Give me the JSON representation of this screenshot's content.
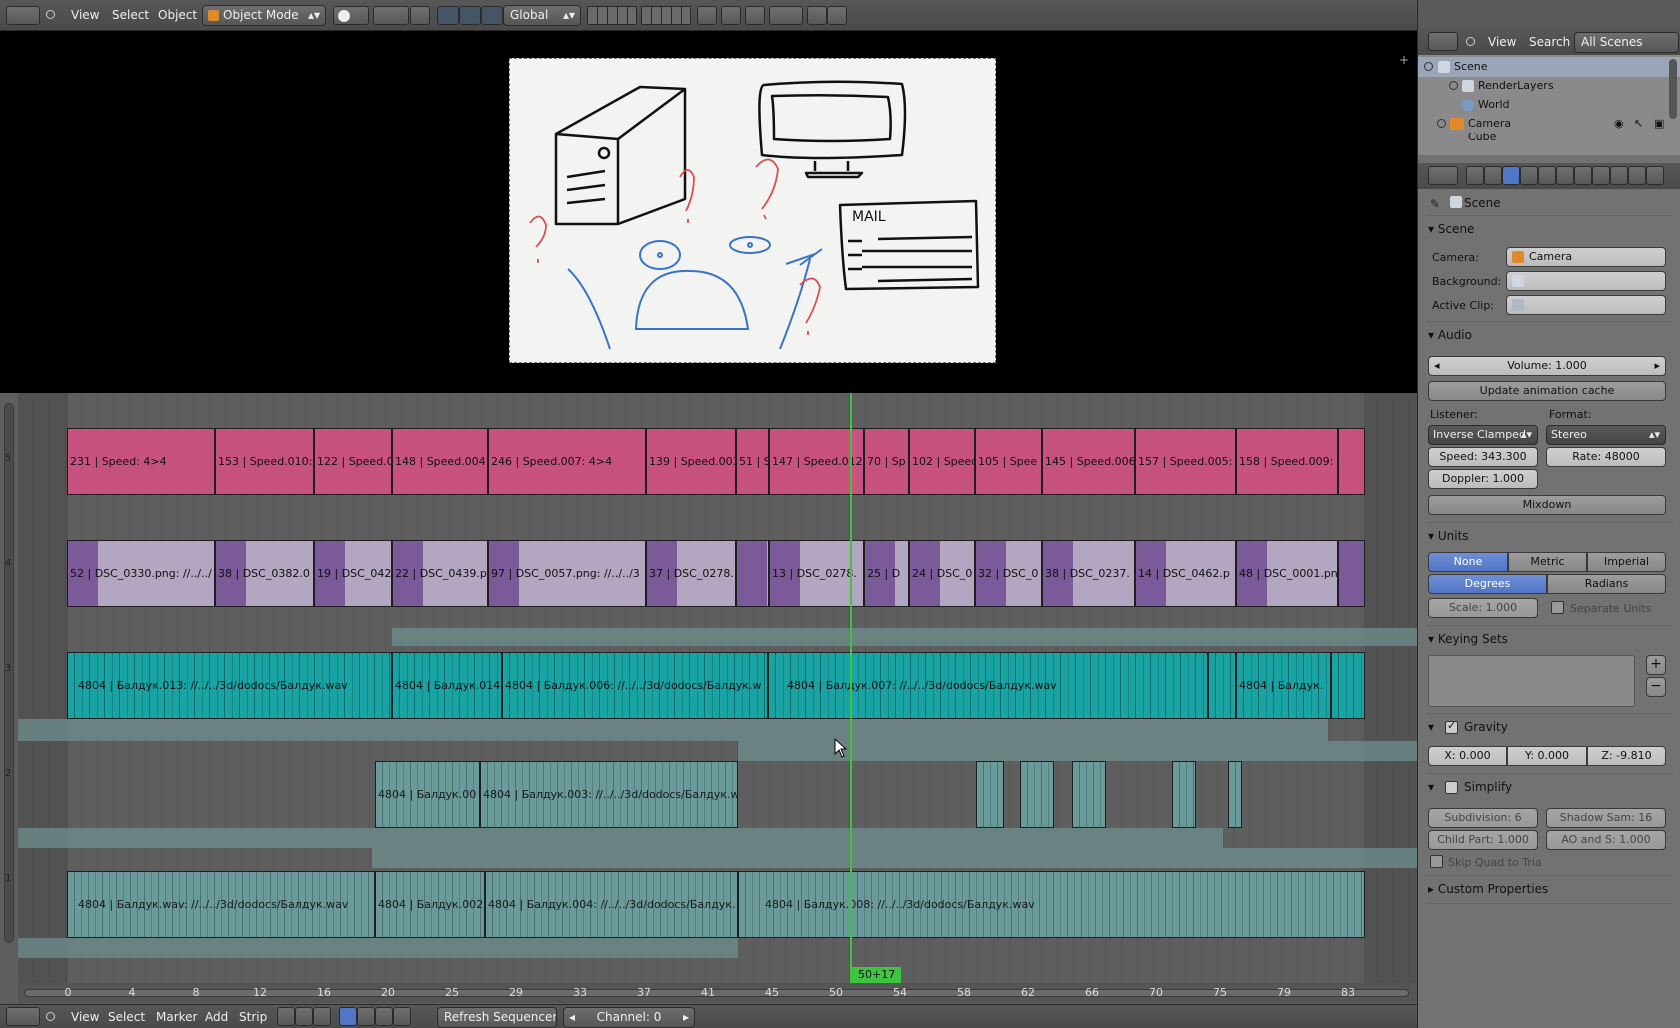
{
  "top_header": {
    "menus": [
      "View",
      "Select",
      "Object"
    ],
    "mode": "Object Mode",
    "orientation": "Global"
  },
  "sequencer": {
    "channels": [
      "5",
      "4",
      "3",
      "2",
      "1"
    ],
    "channel5": [
      "231 | Speed: 4>4",
      "153 | Speed.010: 4",
      "122 | Speed.01",
      "148 | Speed.004:",
      "246 | Speed.007: 4>4",
      "139 | Speed.003:",
      "51 | Sp",
      "147 | Speed.012: 4",
      "70 | Sp",
      "102 | Speed.0",
      "105 | Spee",
      "145 | Speed.006",
      "157 | Speed.005:",
      "158 | Speed.009:"
    ],
    "channel4": [
      "52 | DSC_0330.png: //../../",
      "38 | DSC_0382.0",
      "19 | DSC_042",
      "22 | DSC_0439.p",
      "97 | DSC_0057.png: //../../3",
      "37 | DSC_0278.",
      "",
      "13 | DSC_0278.",
      "25 | D",
      "24 | DSC_0",
      "32 | DSC_0",
      "38 | DSC_0237.",
      "14 | DSC_0462.p",
      "48 | DSC_0001.pn",
      ""
    ],
    "channel3": [
      "4804 | Балдук.013: //../../3d/dodocs/Балдук.wav",
      "4804 | Балдук.014",
      "4804 | Балдук.006: //../../3d/dodocs/Балдук.w",
      "4804 | Балдук.007: //../../3d/dodocs/Балдук.wav",
      "",
      "4804 | Балдук.",
      ""
    ],
    "channel2": [
      "4804 | Балдук.00",
      "4804 | Балдук.003: //../../3d/dodocs/Балдук.w",
      "",
      "",
      "",
      "",
      ""
    ],
    "channel1": [
      "4804 | Балдук.wav: //../../3d/dodocs/Балдук.wav",
      "4804 | Балдук.002",
      "4804 | Балдук.004: //../../3d/dodocs/Балдук.",
      "4804 | Балдук.008: //../../3d/dodocs/Балдук.wav"
    ],
    "current_frame_label": "50+17",
    "ruler_ticks": [
      "0",
      "4",
      "8",
      "12",
      "16",
      "20",
      "25",
      "29",
      "33",
      "37",
      "41",
      "45",
      "50",
      "54",
      "58",
      "62",
      "66",
      "70",
      "75",
      "79",
      "83"
    ]
  },
  "bottom_header": {
    "menus": [
      "View",
      "Select",
      "Marker",
      "Add",
      "Strip"
    ],
    "refresh_label": "Refresh Sequencer",
    "channel_label": "Channel: 0"
  },
  "outliner": {
    "menus": [
      "View",
      "Search"
    ],
    "scene_selector": "All Scenes",
    "items": [
      "Scene",
      "RenderLayers",
      "World",
      "Camera",
      "Cube"
    ]
  },
  "properties": {
    "context_label": "Scene",
    "scene_panel": {
      "title": "Scene",
      "camera_label": "Camera:",
      "camera_value": "Camera",
      "background_label": "Background:",
      "active_clip_label": "Active Clip:"
    },
    "audio_panel": {
      "title": "Audio",
      "volume": "Volume: 1.000",
      "update_cache": "Update animation cache",
      "listener_label": "Listener:",
      "format_label": "Format:",
      "listener_value": "Inverse Clamped",
      "format_value": "Stereo",
      "speed": "Speed: 343.300",
      "rate": "Rate: 48000",
      "doppler": "Doppler: 1.000",
      "mixdown": "Mixdown"
    },
    "units_panel": {
      "title": "Units",
      "systems": [
        "None",
        "Metric",
        "Imperial"
      ],
      "rotation": [
        "Degrees",
        "Radians"
      ],
      "scale": "Scale: 1.000",
      "separate_units": "Separate Units"
    },
    "keying_sets_panel": {
      "title": "Keying Sets"
    },
    "gravity_panel": {
      "title": "Gravity",
      "x": "X: 0.000",
      "y": "Y: 0.000",
      "z": "Z: -9.810"
    },
    "simplify_panel": {
      "title": "Simplify",
      "subdivision": "Subdivision: 6",
      "shadow_samples": "Shadow Sam: 16",
      "child_particles": "Child Part: 1.000",
      "ao_sss": "AO and S: 1.000",
      "skip_quad": "Skip Quad to Tria"
    },
    "custom_properties_panel": {
      "title": "Custom Properties"
    }
  },
  "colors": {
    "effect_strip": "#c8527e",
    "image_strip": "#7a5a99",
    "sound_strip": "#1aa3a3",
    "playhead": "#3ec43e",
    "selected_button": "#5276c6"
  }
}
